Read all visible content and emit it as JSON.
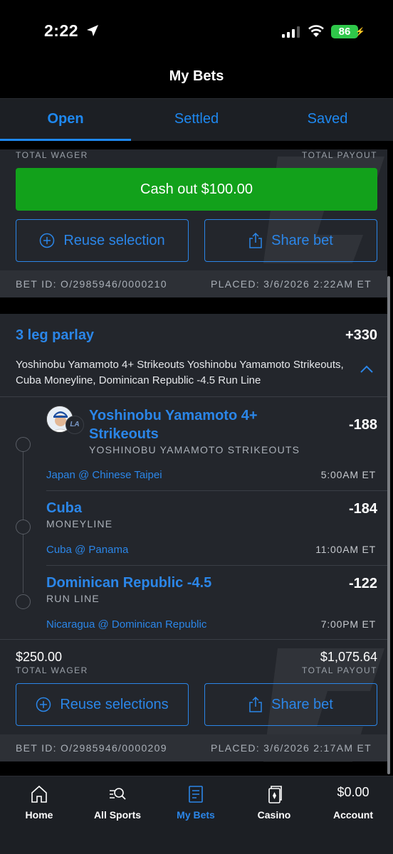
{
  "status_bar": {
    "time": "2:22",
    "battery": "86"
  },
  "header": {
    "title": "My Bets"
  },
  "tabs": [
    {
      "label": "Open",
      "active": true
    },
    {
      "label": "Settled",
      "active": false
    },
    {
      "label": "Saved",
      "active": false
    }
  ],
  "bet1": {
    "total_wager_label": "TOTAL WAGER",
    "total_payout_label": "TOTAL PAYOUT",
    "cash_out_label": "Cash out $100.00",
    "reuse_label": "Reuse selection",
    "share_label": "Share bet",
    "bet_id": "BET ID: O/2985946/0000210",
    "placed": "PLACED: 3/6/2026 2:22AM ET"
  },
  "bet2": {
    "title": "3 leg parlay",
    "odds": "+330",
    "description": "Yoshinobu Yamamoto 4+ Strikeouts Yoshinobu Yamamoto Strikeouts, Cuba Moneyline, Dominican Republic -4.5 Run Line",
    "legs": [
      {
        "title": "Yoshinobu Yamamoto 4+ Strikeouts",
        "market": "YOSHINOBU YAMAMOTO STRIKEOUTS",
        "odds": "-188",
        "matchup": "Japan @ Chinese Taipei",
        "time": "5:00AM ET",
        "team_badge": "LA"
      },
      {
        "title": "Cuba",
        "market": "MONEYLINE",
        "odds": "-184",
        "matchup": "Cuba @ Panama",
        "time": "11:00AM ET"
      },
      {
        "title": "Dominican Republic -4.5",
        "market": "RUN LINE",
        "odds": "-122",
        "matchup": "Nicaragua @ Dominican Republic",
        "time": "7:00PM ET"
      }
    ],
    "total_wager": "$250.00",
    "total_wager_label": "TOTAL WAGER",
    "total_payout": "$1,075.64",
    "total_payout_label": "TOTAL PAYOUT",
    "reuse_label": "Reuse selections",
    "share_label": "Share bet",
    "bet_id": "BET ID: O/2985946/0000209",
    "placed": "PLACED: 3/6/2026 2:17AM ET"
  },
  "bottom_nav": [
    {
      "label": "Home",
      "icon": "home-icon"
    },
    {
      "label": "All Sports",
      "icon": "all-sports-icon"
    },
    {
      "label": "My Bets",
      "icon": "my-bets-icon",
      "active": true
    },
    {
      "label": "Casino",
      "icon": "casino-icon"
    },
    {
      "label": "Account",
      "balance": "$0.00"
    }
  ],
  "colors": {
    "accent": "#2b86e8",
    "cash_out": "#12a11b",
    "card": "#23262c"
  }
}
